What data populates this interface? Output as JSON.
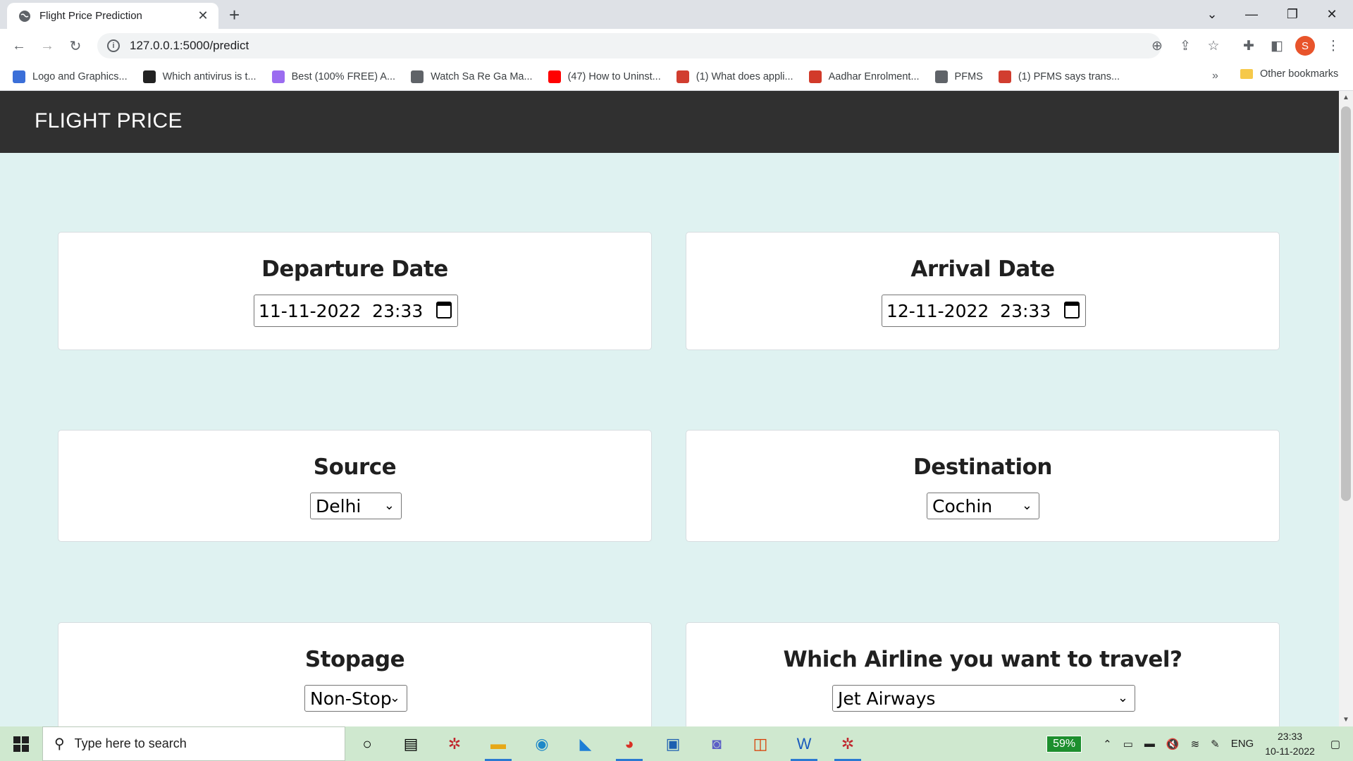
{
  "browser": {
    "tab_title": "Flight Price Prediction",
    "url": "127.0.0.1:5000/predict",
    "profile_initial": "S",
    "bookmarks": [
      {
        "label": "Logo and Graphics...",
        "icon": "logo-icon",
        "color": "#3b6fd8"
      },
      {
        "label": "Which antivirus is t...",
        "icon": "antivirus-icon",
        "color": "#222222"
      },
      {
        "label": "Best (100% FREE) A...",
        "icon": "star-logo-icon",
        "color": "#9b6cf0"
      },
      {
        "label": "Watch Sa Re Ga Ma...",
        "icon": "globe-icon",
        "color": "#5f6368"
      },
      {
        "label": "(47) How to Uninst...",
        "icon": "youtube-icon",
        "color": "#ff0000"
      },
      {
        "label": "(1) What does appli...",
        "icon": "quora-icon",
        "color": "#d13d2f"
      },
      {
        "label": "Aadhar Enrolment...",
        "icon": "aadhar-icon",
        "color": "#d23a2a"
      },
      {
        "label": "PFMS",
        "icon": "globe-icon",
        "color": "#5f6368"
      },
      {
        "label": "(1) PFMS says trans...",
        "icon": "quora-icon",
        "color": "#d13d2f"
      }
    ],
    "other_bookmarks": "Other bookmarks"
  },
  "app": {
    "brand": "FLIGHT PRICE",
    "departure": {
      "label": "Departure Date",
      "value": "11-11-2022  23:33"
    },
    "arrival": {
      "label": "Arrival Date",
      "value": "12-11-2022  23:33"
    },
    "source": {
      "label": "Source",
      "value": "Delhi"
    },
    "destination": {
      "label": "Destination",
      "value": "Cochin"
    },
    "stopage": {
      "label": "Stopage",
      "value": "Non-Stop"
    },
    "airline": {
      "label": "Which Airline you want to travel?",
      "value": "Jet Airways"
    }
  },
  "taskbar": {
    "search_placeholder": "Type here to search",
    "battery": "59%",
    "language": "ENG",
    "time": "23:33",
    "date": "10-11-2022"
  }
}
